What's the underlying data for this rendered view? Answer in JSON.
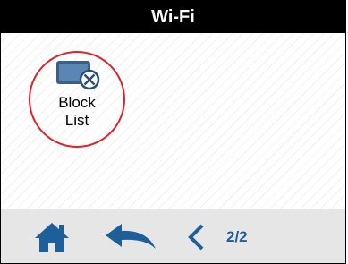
{
  "header": {
    "title": "Wi-Fi"
  },
  "items": [
    {
      "label_line1": "Block",
      "label_line2": "List",
      "icon": "block-list-icon",
      "highlighted": true,
      "highlight_color": "#e0202a"
    }
  ],
  "footer": {
    "home_icon": "home-icon",
    "back_icon": "back-arrow-icon",
    "prev_icon": "chevron-left-icon",
    "page_indicator": "2/2"
  },
  "colors": {
    "accent": "#1f5f99",
    "titlebar": "#000000",
    "navbar": "#e6e6e6",
    "highlight": "#e0202a"
  }
}
